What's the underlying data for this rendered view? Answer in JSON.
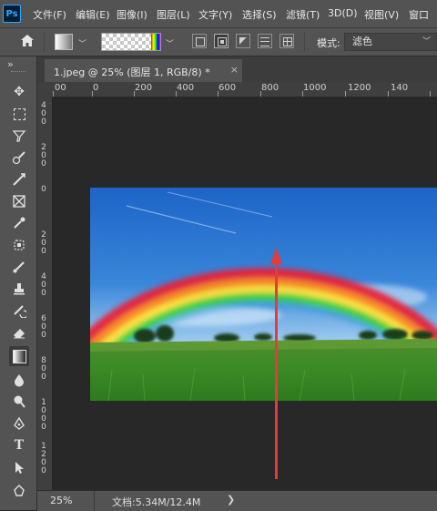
{
  "app": {
    "logo": "Ps"
  },
  "menu": [
    {
      "label": "文件(F)"
    },
    {
      "label": "编辑(E)"
    },
    {
      "label": "图像(I)"
    },
    {
      "label": "图层(L)"
    },
    {
      "label": "文字(Y)"
    },
    {
      "label": "选择(S)"
    },
    {
      "label": "滤镜(T)"
    },
    {
      "label": "3D(D)"
    },
    {
      "label": "视图(V)"
    },
    {
      "label": "窗口"
    }
  ],
  "options": {
    "home_icon": "home-icon",
    "gradient_tool_icon": "gradient-swatch",
    "mode_label": "模式:",
    "mode_value": "滤色",
    "gradient_types": [
      "linear",
      "radial",
      "angle",
      "reflected",
      "diamond"
    ],
    "active_gradient_type": "radial"
  },
  "document": {
    "tab_title": "1.jpeg @ 25% (图层 1, RGB/8) *",
    "close_glyph": "×",
    "panel_collapse_glyph": "»"
  },
  "ruler": {
    "top_labels": [
      "00",
      "0",
      "200",
      "400",
      "600",
      "800",
      "1000",
      "1200",
      "140"
    ],
    "left_labels": [
      "400",
      "200",
      "0",
      "200",
      "400",
      "600",
      "800",
      "1000",
      "1200"
    ]
  },
  "tools": [
    "move-icon",
    "marquee-icon",
    "lasso-icon",
    "quick-select-icon",
    "crop-icon",
    "frame-icon",
    "eyedropper-icon",
    "healing-icon",
    "brush-icon",
    "stamp-icon",
    "history-brush-icon",
    "eraser-icon",
    "gradient-icon",
    "blur-icon",
    "dodge-icon",
    "pen-icon",
    "type-icon",
    "path-select-icon",
    "shape-icon"
  ],
  "active_tool": "gradient-icon",
  "status": {
    "zoom": "25%",
    "doc_info": "文档:5.34M/12.4M",
    "arrow": "❯"
  },
  "colors": {
    "panel": "#535353",
    "canvas_bg": "#282828",
    "annotation_arrow": "#e23c3c",
    "ps_blue": "#31a8ff"
  }
}
